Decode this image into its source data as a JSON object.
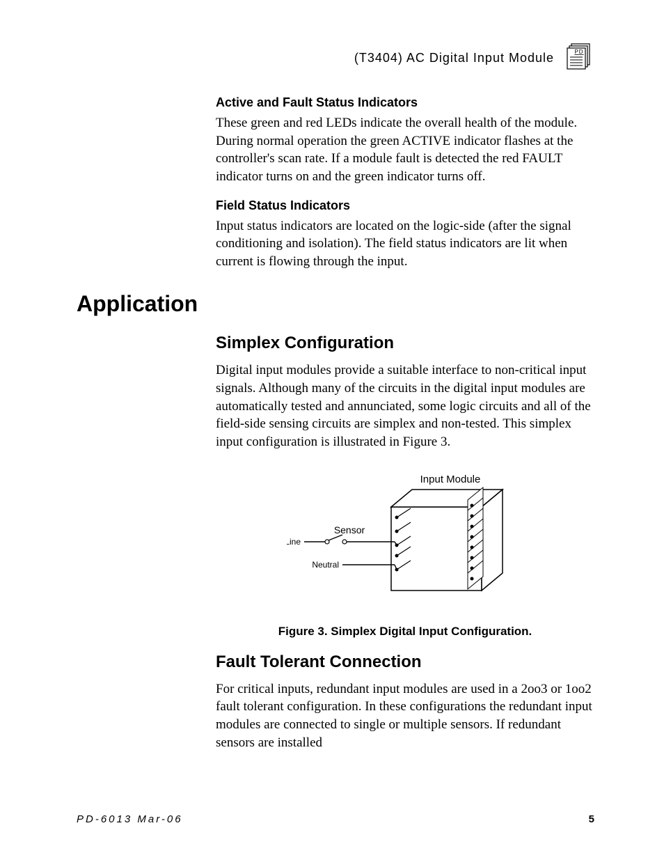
{
  "header": {
    "title": "(T3404) AC Digital Input Module",
    "icon_badge": "PD"
  },
  "section1": {
    "heading": "Active and Fault Status Indicators",
    "text": "These green and red LEDs indicate the overall health of the module.  During normal operation the green ACTIVE indicator flashes at the controller's scan rate.  If a module fault is detected the red FAULT indicator turns on and the green indicator turns off."
  },
  "section2": {
    "heading": "Field Status Indicators",
    "text": "Input status indicators are located on the logic-side (after the signal conditioning and isolation).  The field status indicators are lit when current is flowing through the input."
  },
  "application": {
    "title": "Application",
    "simplex": {
      "heading": "Simplex Configuration",
      "text": "Digital input modules provide a suitable interface to non-critical input signals.  Although many of the circuits in the digital input modules are automatically tested and annunciated, some logic circuits and all of the field-side sensing circuits are simplex and non-tested.  This simplex input configuration is illustrated in Figure 3."
    },
    "figure": {
      "labels": {
        "module": "Input Module",
        "sensor": "Sensor",
        "line": "Line",
        "neutral": "Neutral"
      },
      "caption": "Figure 3.  Simplex Digital Input Configuration."
    },
    "fault": {
      "heading": "Fault Tolerant Connection",
      "text": "For critical inputs, redundant input modules are used in a 2oo3 or 1oo2 fault tolerant configuration. In these configurations the redundant input modules are connected to single or multiple sensors.   If redundant sensors are installed"
    }
  },
  "footer": {
    "left": "PD-6013 Mar-06",
    "right": "5"
  }
}
